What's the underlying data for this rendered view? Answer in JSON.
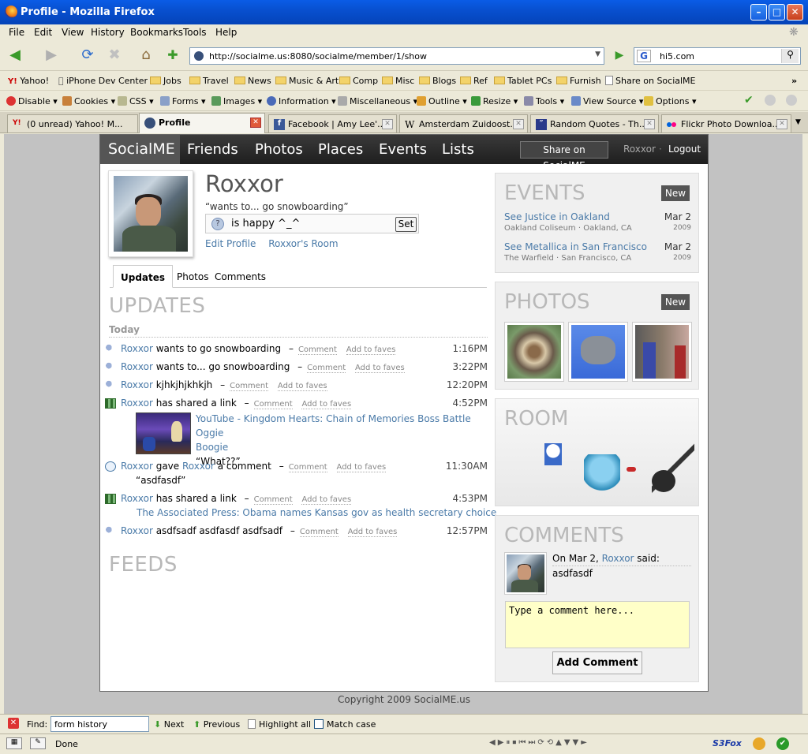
{
  "window": {
    "title": "Profile - Mozilla Firefox"
  },
  "menu": [
    "File",
    "Edit",
    "View",
    "History",
    "Bookmarks",
    "Tools",
    "Help"
  ],
  "nav": {
    "url": "http://socialme.us:8080/socialme/member/1/show",
    "search": "hi5.com",
    "search_engine": "G"
  },
  "bookmarks": [
    "Yahoo!",
    "iPhone Dev Center",
    "Jobs",
    "Travel",
    "News",
    "Music & Art",
    "Comp",
    "Misc",
    "Blogs",
    "Ref",
    "Tablet PCs",
    "Furnish",
    "Share on SocialME"
  ],
  "devbar": [
    "Disable",
    "Cookies",
    "CSS",
    "Forms",
    "Images",
    "Information",
    "Miscellaneous",
    "Outline",
    "Resize",
    "Tools",
    "View Source",
    "Options"
  ],
  "tabs": [
    "(0 unread) Yahoo! M...",
    "Profile",
    "Facebook | Amy Lee'...",
    "Amsterdam Zuidoost...",
    "Random Quotes - Th...",
    "Flickr Photo Downloa..."
  ],
  "site": {
    "logo": "SocialME",
    "nav": [
      "Friends",
      "Photos",
      "Places",
      "Events",
      "Lists"
    ],
    "share": "Share on SocialME",
    "user": "Roxxor",
    "sep": "·",
    "logout": "Logout"
  },
  "profile": {
    "name": "Roxxor",
    "status": "“wants to... go snowboarding”",
    "input_value": "is happy ^_^",
    "set": "Set",
    "edit": "Edit Profile",
    "room": "Roxxor's Room"
  },
  "ptabs": [
    "Updates",
    "Photos",
    "Comments"
  ],
  "updates": {
    "heading": "UPDATES",
    "today": "Today",
    "comment": "Comment",
    "faves": "Add to faves",
    "dash": "–",
    "items": [
      {
        "who": "Roxxor",
        "text": " wants to go snowboarding",
        "time": "1:16PM"
      },
      {
        "who": "Roxxor",
        "text": " wants to... go snowboarding",
        "time": "3:22PM"
      },
      {
        "who": "Roxxor",
        "text": " kjhkjhjkhkjh",
        "time": "12:20PM"
      },
      {
        "who": "Roxxor",
        "text": " has shared a link",
        "time": "4:52PM",
        "link": "YouTube - Kingdom Hearts: Chain of Memories Boss Battle Oggie",
        "link2": "Boogie",
        "quote": "“What??”"
      },
      {
        "who": "Roxxor",
        "pre": " gave ",
        "who2": "Roxxor",
        "text": " a comment",
        "time": "11:30AM",
        "quote": "“asdfasdf”"
      },
      {
        "who": "Roxxor",
        "text": " has shared a link",
        "time": "4:53PM",
        "link": "The Associated Press: Obama names Kansas gov as health secretary choice"
      },
      {
        "who": "Roxxor",
        "text": " asdfsadf asdfasdf asdfsadf",
        "time": "12:57PM"
      }
    ]
  },
  "feeds": {
    "heading": "FEEDS"
  },
  "events": {
    "heading": "EVENTS",
    "new": "New",
    "items": [
      {
        "title": "See Justice in Oakland",
        "where": "Oakland Coliseum · Oakland, CA",
        "date": "Mar 2",
        "year": "2009"
      },
      {
        "title": "See Metallica in San Francisco",
        "where": "The Warfield · San Francisco, CA",
        "date": "Mar 2",
        "year": "2009"
      }
    ]
  },
  "photos": {
    "heading": "PHOTOS",
    "new": "New"
  },
  "room": {
    "heading": "ROOM"
  },
  "comments": {
    "heading": "COMMENTS",
    "pre": "On Mar 2, ",
    "who": "Roxxor",
    "post": " said:",
    "text": "asdfasdf",
    "placeholder": "Type a comment here...",
    "button": "Add Comment"
  },
  "footer": "Copyright 2009 SocialME.us",
  "findbar": {
    "label": "Find:",
    "value": "form history",
    "next": "Next",
    "previous": "Previous",
    "highlight": "Highlight all",
    "match": "Match case"
  },
  "status": {
    "text": "Done",
    "s3fox": "S3Fox"
  }
}
